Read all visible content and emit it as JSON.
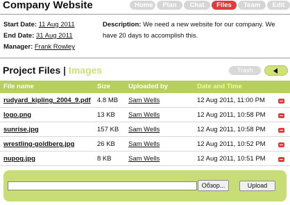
{
  "app": {
    "title": "Company Website"
  },
  "tabs": [
    {
      "label": "Home",
      "active": false
    },
    {
      "label": "Plan",
      "active": false
    },
    {
      "label": "Chat",
      "active": false
    },
    {
      "label": "Files",
      "active": true
    },
    {
      "label": "Team",
      "active": false
    },
    {
      "label": "Edit",
      "active": false
    }
  ],
  "project": {
    "start_label": "Start Date:",
    "start_date": "11 Aug 2011",
    "end_label": "End Date:",
    "end_date": "31 Aug 2011",
    "manager_label": "Manager:",
    "manager": "Frank Rowley",
    "description_label": "Description:",
    "description": "We need a new website for our company. We have 20 days to accomplish this."
  },
  "section": {
    "title": "Project Files",
    "separator": "|",
    "alt_view": "Images",
    "trash_label": "Trash"
  },
  "table": {
    "columns": [
      "File name",
      "Size",
      "Uploaded by",
      "Date and Time"
    ],
    "rows": [
      {
        "name": "rudyard_kipling_2004_9.pdf",
        "size": "4.8 MB",
        "user": "Sam Wells",
        "date": "12 Aug 2011, 11:00 PM"
      },
      {
        "name": "logo.png",
        "size": "13 KB",
        "user": "Sam Wells",
        "date": "12 Aug 2011, 10:58 PM"
      },
      {
        "name": "sunrise.jpg",
        "size": "157 KB",
        "user": "Sam Wells",
        "date": "12 Aug 2011, 10:58 PM"
      },
      {
        "name": "wrestling-goldberg.jpg",
        "size": "26 KB",
        "user": "Sam Wells",
        "date": "12 Aug 2011, 10:52 PM"
      },
      {
        "name": "nupog.jpg",
        "size": "8 KB",
        "user": "Sam Wells",
        "date": "12 Aug 2011, 10:51 PM"
      }
    ]
  },
  "upload": {
    "file_value": "",
    "browse_label": "Обзор...",
    "upload_label": "Upload"
  },
  "colors": {
    "accent": "#b7cf5b",
    "active_tab": "#e23b3b",
    "inactive_tab": "#d6d6d6"
  }
}
